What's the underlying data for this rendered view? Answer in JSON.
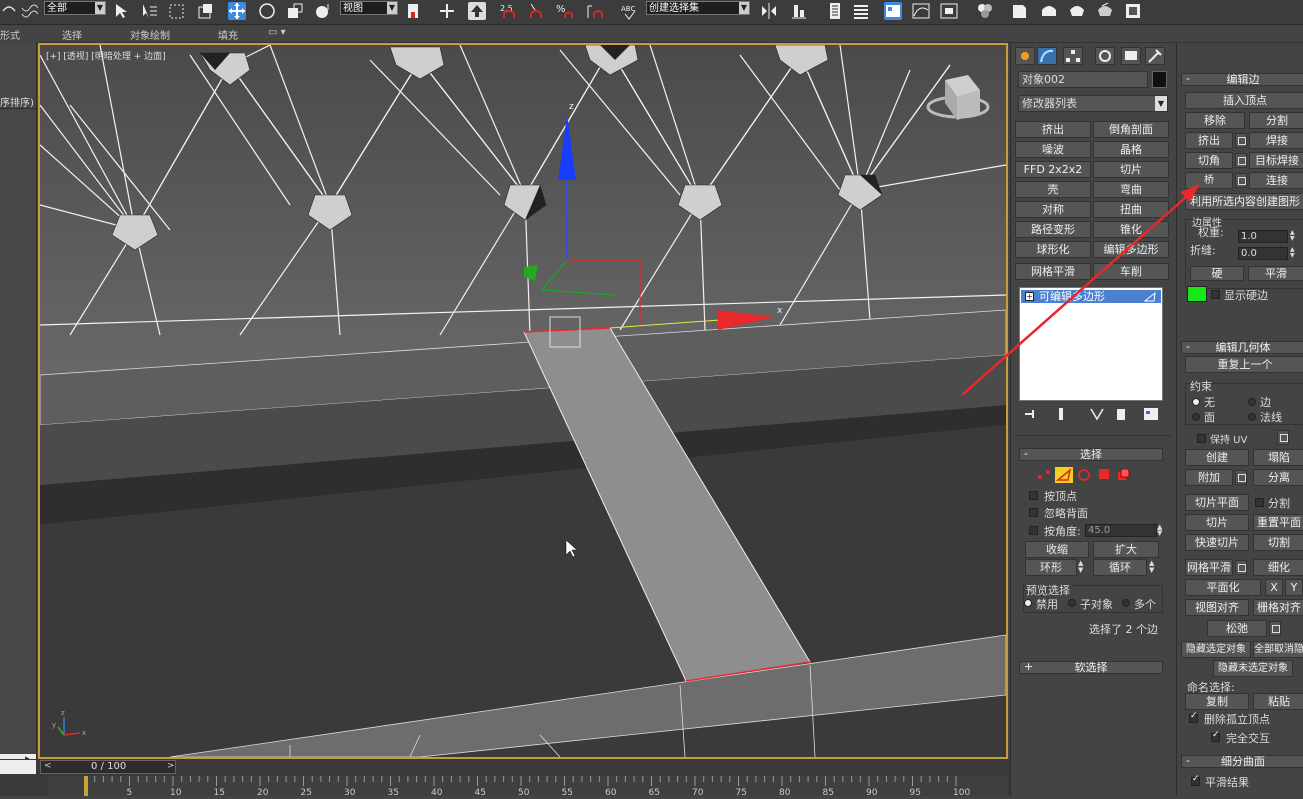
{
  "toolbar": {
    "selection_filter": "全部",
    "ref_coord": "视图",
    "named_selection": "创建选择集",
    "snap_value": "2.5"
  },
  "ribbon": {
    "items": [
      "形式",
      "选择",
      "对象绘制",
      "填充"
    ]
  },
  "left_strip": {
    "label": "序排序)"
  },
  "viewport": {
    "label": "[+] [透视] [明暗处理 + 边面]",
    "gizmo_x": "x",
    "gizmo_z": "z",
    "axis_x": "x",
    "axis_y": "y",
    "axis_z": "z"
  },
  "timeline": {
    "frame": "0 / 100",
    "ticks": [
      "5",
      "10",
      "15",
      "20",
      "25",
      "30",
      "35",
      "40",
      "45",
      "50",
      "55",
      "60",
      "65",
      "70",
      "75",
      "80",
      "85",
      "90",
      "95",
      "100"
    ]
  },
  "command_panel": {
    "object_name": "对象002",
    "modifier_list": "修改器列表",
    "modifier_buttons": [
      [
        "挤出",
        "倒角剖面"
      ],
      [
        "噪波",
        "晶格"
      ],
      [
        "FFD 2x2x2",
        "切片"
      ],
      [
        "壳",
        "弯曲"
      ],
      [
        "对称",
        "扭曲"
      ],
      [
        "路径变形",
        "锥化"
      ],
      [
        "球形化",
        "编辑多边形"
      ],
      [
        "网格平滑",
        "车削"
      ]
    ],
    "stack_item": "可编辑多边形",
    "selection": {
      "title": "选择",
      "by_vertex": "按顶点",
      "ignore_backfacing": "忽略背面",
      "by_angle": "按角度:",
      "angle_value": "45.0",
      "shrink": "收缩",
      "grow": "扩大",
      "ring": "环形",
      "loop": "循环",
      "preview_title": "预览选择",
      "preview_disable": "禁用",
      "preview_subobj": "子对象",
      "preview_multi": "多个",
      "status": "选择了 2 个边"
    },
    "soft_selection": "软选择"
  },
  "edit_edges": {
    "title": "编辑边",
    "insert_vertex": "插入顶点",
    "remove": "移除",
    "split": "分割",
    "extrude": "挤出",
    "weld": "焊接",
    "chamfer": "切角",
    "target_weld": "目标焊接",
    "bridge": "桥",
    "connect": "连接",
    "create_shape": "利用所选内容创建图形",
    "edge_props": "边属性",
    "weight_label": "权重:",
    "weight_value": "1.0",
    "crease_label": "折缝:",
    "crease_value": "0.0",
    "hard": "硬",
    "smooth": "平滑",
    "show_hard": "显示硬边",
    "hard_color": "#19e619"
  },
  "edit_geometry": {
    "title": "编辑几何体",
    "repeat_last": "重复上一个",
    "constraints": "约束",
    "c_none": "无",
    "c_edge": "边",
    "c_face": "面",
    "c_normal": "法线",
    "preserve_uv": "保持 UV",
    "create": "创建",
    "collapse": "塌陷",
    "attach": "附加",
    "detach": "分离",
    "slice_plane": "切片平面",
    "split": "分割",
    "slice": "切片",
    "reset_plane": "重置平面",
    "quickslice": "快速切片",
    "cut": "切割",
    "meshsmooth": "网格平滑",
    "tessellate": "细化",
    "make_planar": "平面化",
    "x": "X",
    "y": "Y",
    "view_align": "视图对齐",
    "grid_align": "栅格对齐",
    "relax": "松弛",
    "hide_selected": "隐藏选定对象",
    "unhide_all": "全部取消隐藏",
    "hide_unselected": "隐藏未选定对象",
    "named_sel": "命名选择:",
    "copy": "复制",
    "paste": "粘贴",
    "delete_isolated": "删除孤立顶点",
    "full_interop": "完全交互"
  },
  "subdivision": {
    "title": "细分曲面",
    "smooth_result": "平滑结果"
  },
  "colors": {
    "accent_yellow": "#c89b3c",
    "selection_blue": "#4a7fd1",
    "arrow_red": "#e8282a"
  }
}
